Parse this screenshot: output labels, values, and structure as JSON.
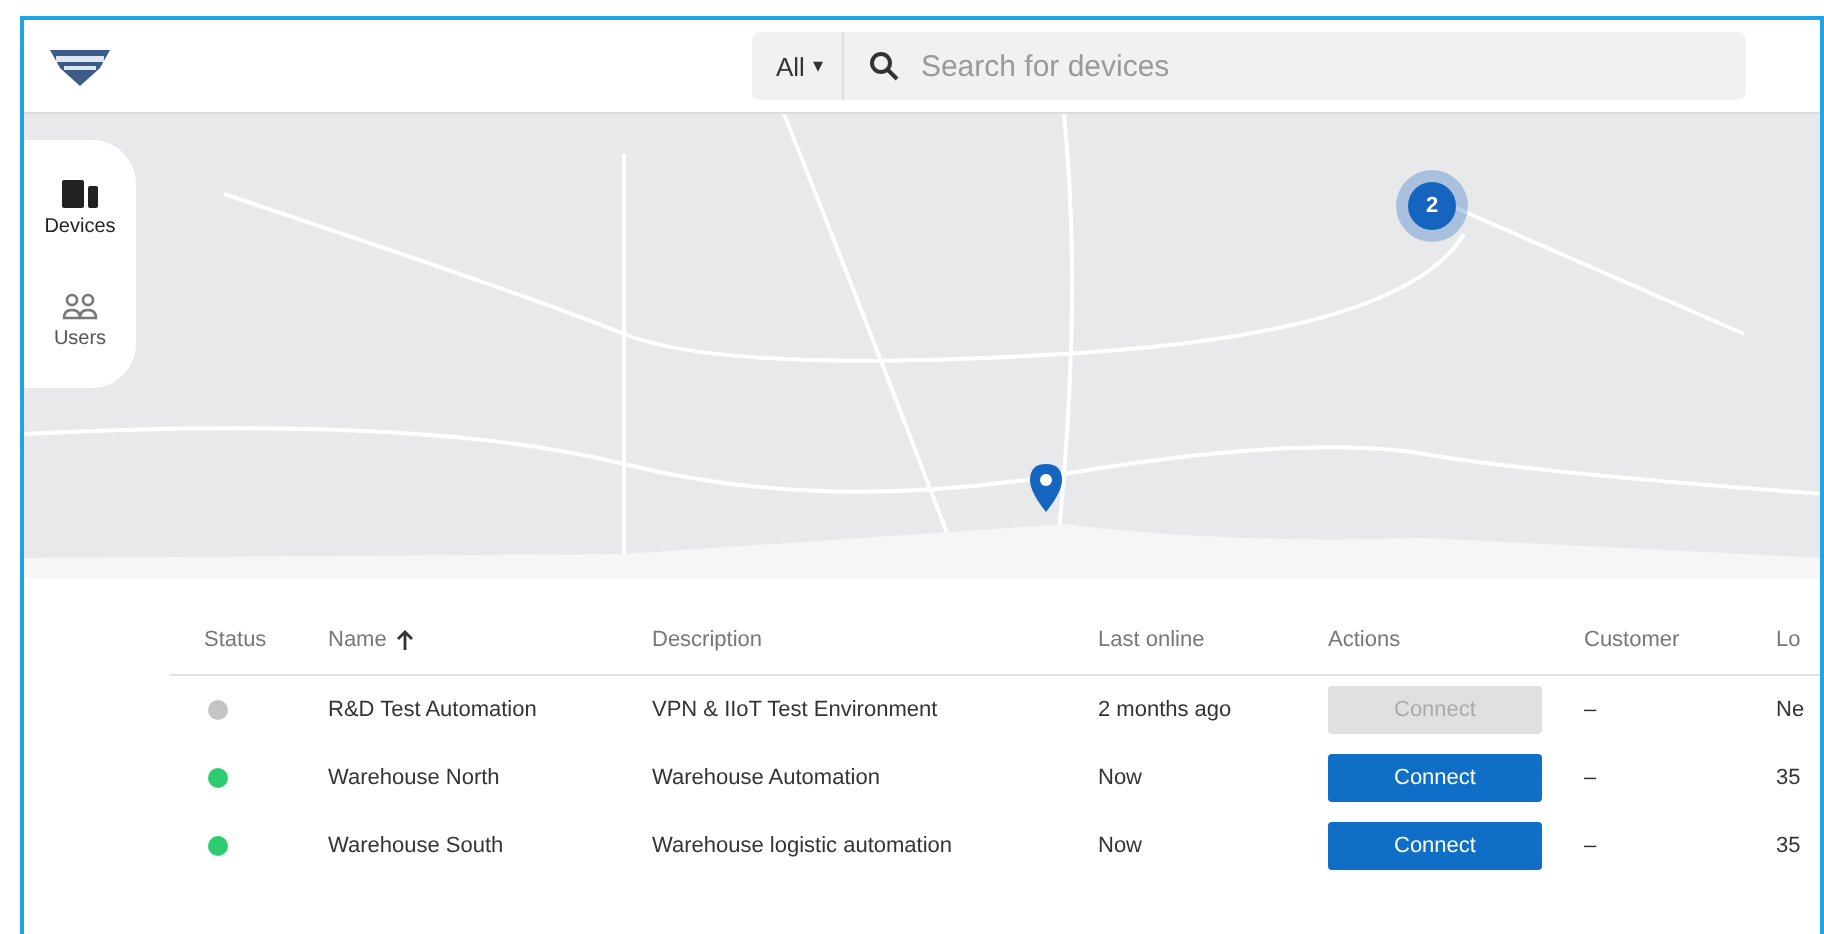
{
  "header": {
    "filter": {
      "label": "All",
      "caret": "▾"
    },
    "search": {
      "placeholder": "Search for devices"
    }
  },
  "sidebar": {
    "items": [
      {
        "label": "Devices",
        "selected": true
      },
      {
        "label": "Users",
        "selected": false
      }
    ]
  },
  "map": {
    "cluster": {
      "count": "2"
    }
  },
  "table": {
    "columns": [
      {
        "label": "Status"
      },
      {
        "label": "Name",
        "sorted": true
      },
      {
        "label": "Description"
      },
      {
        "label": "Last online"
      },
      {
        "label": "Actions"
      },
      {
        "label": "Customer"
      },
      {
        "label": "Lo"
      }
    ],
    "rows": [
      {
        "color": "#c4c4c4",
        "name": "R&D Test Automation",
        "description": "VPN & IIoT Test Environment",
        "last_online": "2 months ago",
        "action": {
          "label": "Connect",
          "disabled": true
        },
        "customer": "–",
        "column_7": "Ne"
      },
      {
        "color": "#2ecc71",
        "name": "Warehouse North",
        "description": "Warehouse Automation",
        "last_online": "Now",
        "action": {
          "label": "Connect",
          "disabled": false
        },
        "customer": "–",
        "column_7": "35"
      },
      {
        "color": "#2ecc71",
        "name": "Warehouse South",
        "description": "Warehouse logistic automation",
        "last_online": "Now",
        "action": {
          "label": "Connect",
          "disabled": false
        },
        "customer": "–",
        "column_7": "35"
      }
    ]
  }
}
